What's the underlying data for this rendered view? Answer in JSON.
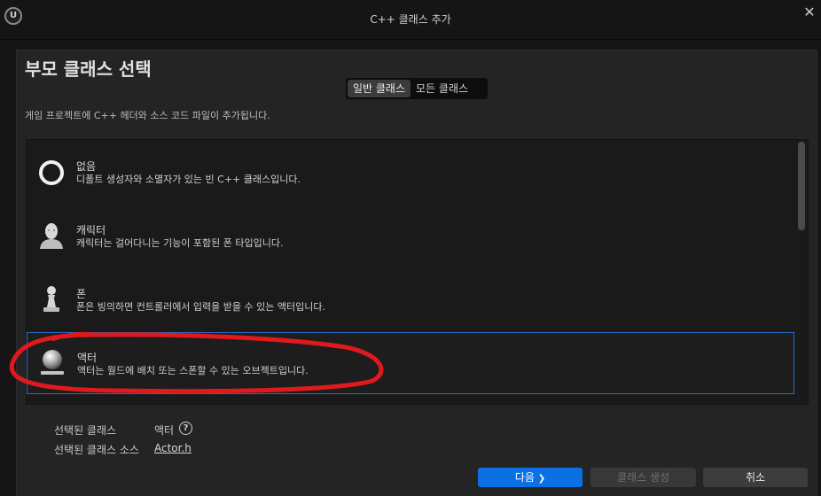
{
  "window": {
    "title": "C++ 클래스 추가",
    "logo_text": "U",
    "close_glyph": "✕"
  },
  "header": {
    "title": "부모 클래스 선택",
    "description": "게임 프로젝트에 C++ 헤더와 소스 코드 파일이 추가됩니다."
  },
  "tabs": [
    {
      "label": "일반 클래스",
      "active": true
    },
    {
      "label": "모든 클래스",
      "active": false
    }
  ],
  "classes": [
    {
      "name": "없음",
      "description": "디폴트 생성자와 소멸자가 있는 빈 C++ 클래스입니다.",
      "icon": "empty-ring-icon",
      "selected": false
    },
    {
      "name": "캐릭터",
      "description": "캐릭터는 걸어다니는 기능이 포함된 폰 타입입니다.",
      "icon": "character-head-icon",
      "selected": false
    },
    {
      "name": "폰",
      "description": "폰은 빙의하면 컨트롤러에서 입력을 받을 수 있는 액터입니다.",
      "icon": "pawn-icon",
      "selected": false
    },
    {
      "name": "액터",
      "description": "액터는 월드에 배치 또는 스폰할 수 있는 오브젝트입니다.",
      "icon": "actor-sphere-icon",
      "selected": true
    }
  ],
  "selection": {
    "class_label": "선택된 클래스",
    "class_value": "액터",
    "source_label": "선택된 클래스 소스",
    "source_value": "Actor.h",
    "help_glyph": "?"
  },
  "buttons": {
    "next": "다음",
    "next_glyph": "❯",
    "create": "클래스 생성",
    "cancel": "취소"
  },
  "colors": {
    "background": "#242424",
    "list_background": "#1a1a1a",
    "accent": "#0b70e4",
    "selection_border": "#2a6ccc",
    "annotation": "#e0191d"
  }
}
